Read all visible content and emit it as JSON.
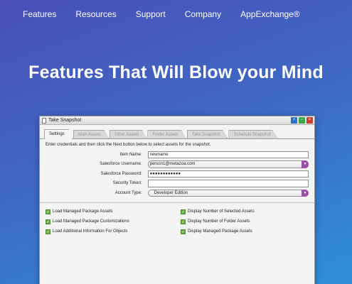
{
  "nav": {
    "items": [
      "Features",
      "Resources",
      "Support",
      "Company",
      "AppExchange®"
    ]
  },
  "hero": {
    "title": "Features That Will Blow your Mind"
  },
  "window": {
    "title": "Take Snapshot",
    "tabs": [
      "Settings",
      "Main Assets",
      "Other Assets",
      "Folder Assets",
      "Take Snapshot",
      "Schedule Snapshot"
    ],
    "active_tab": "Settings",
    "intro": "Enter credentials and then click the Next button below to select assets for the snapshot.",
    "fields": {
      "item_name": {
        "label": "Item Name:",
        "value": "newname"
      },
      "username": {
        "label": "Salesforce Username:",
        "value": "person1@metazoa.com"
      },
      "password": {
        "label": "Salesforce Password:",
        "value": "●●●●●●●●●●●●"
      },
      "token": {
        "label": "Security Token:",
        "value": ""
      },
      "account_type": {
        "label": "Account Type:",
        "value": "Developer Edition"
      }
    },
    "checks": [
      "Load Managed Package Assets",
      "Display Number of Selected Assets",
      "Load Managed Package Customizations",
      "Display Number of Folder Assets",
      "Load Additional Information For Objects",
      "Display Managed Package Assets"
    ],
    "colors": {
      "check": "#6cb04a",
      "dropdown": "#9b4fa8"
    }
  }
}
